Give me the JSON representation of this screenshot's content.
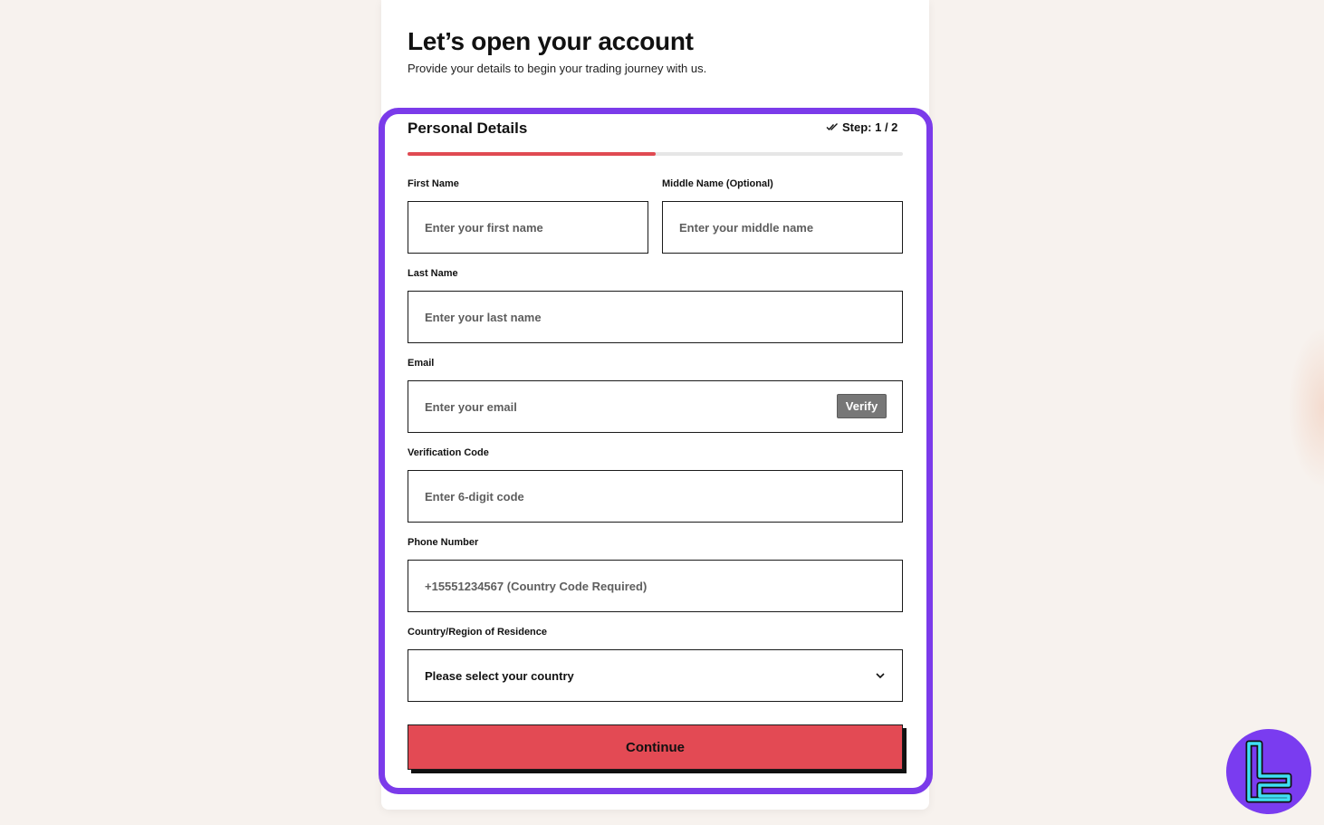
{
  "page": {
    "title": "Let’s open your account",
    "subtitle": "Provide your details to begin your trading journey with us."
  },
  "form": {
    "section_title": "Personal Details",
    "step_label": "Step: 1 / 2",
    "progress_fraction": 0.5,
    "fields": {
      "first_name": {
        "label": "First Name",
        "placeholder": "Enter your first name",
        "value": ""
      },
      "middle_name": {
        "label": "Middle Name (Optional)",
        "placeholder": "Enter your middle name",
        "value": ""
      },
      "last_name": {
        "label": "Last Name",
        "placeholder": "Enter your last name",
        "value": ""
      },
      "email": {
        "label": "Email",
        "placeholder": "Enter your email",
        "value": "",
        "verify_label": "Verify"
      },
      "verification_code": {
        "label": "Verification Code",
        "placeholder": "Enter 6-digit code",
        "value": ""
      },
      "phone": {
        "label": "Phone Number",
        "placeholder": "+15551234567 (Country Code Required)",
        "value": ""
      },
      "country": {
        "label": "Country/Region of Residence",
        "selected": "Please select your country"
      }
    },
    "continue_label": "Continue"
  },
  "colors": {
    "accent_red": "#e34a54",
    "highlight_purple": "#7b3bea",
    "background": "#f7f2ee",
    "logo_cyan": "#3fe0f5"
  },
  "icons": {
    "step_icon": "double-check-icon",
    "select_icon": "chevron-down-icon",
    "logo": "tradingfinder-logo-icon"
  }
}
